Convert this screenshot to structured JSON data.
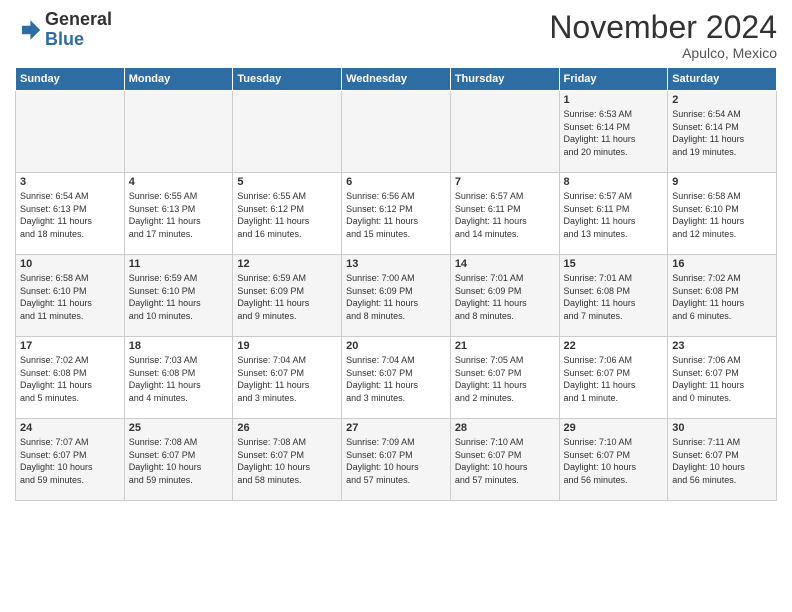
{
  "header": {
    "logo_line1": "General",
    "logo_line2": "Blue",
    "month": "November 2024",
    "location": "Apulco, Mexico"
  },
  "weekdays": [
    "Sunday",
    "Monday",
    "Tuesday",
    "Wednesday",
    "Thursday",
    "Friday",
    "Saturday"
  ],
  "weeks": [
    [
      {
        "day": "",
        "info": ""
      },
      {
        "day": "",
        "info": ""
      },
      {
        "day": "",
        "info": ""
      },
      {
        "day": "",
        "info": ""
      },
      {
        "day": "",
        "info": ""
      },
      {
        "day": "1",
        "info": "Sunrise: 6:53 AM\nSunset: 6:14 PM\nDaylight: 11 hours\nand 20 minutes."
      },
      {
        "day": "2",
        "info": "Sunrise: 6:54 AM\nSunset: 6:14 PM\nDaylight: 11 hours\nand 19 minutes."
      }
    ],
    [
      {
        "day": "3",
        "info": "Sunrise: 6:54 AM\nSunset: 6:13 PM\nDaylight: 11 hours\nand 18 minutes."
      },
      {
        "day": "4",
        "info": "Sunrise: 6:55 AM\nSunset: 6:13 PM\nDaylight: 11 hours\nand 17 minutes."
      },
      {
        "day": "5",
        "info": "Sunrise: 6:55 AM\nSunset: 6:12 PM\nDaylight: 11 hours\nand 16 minutes."
      },
      {
        "day": "6",
        "info": "Sunrise: 6:56 AM\nSunset: 6:12 PM\nDaylight: 11 hours\nand 15 minutes."
      },
      {
        "day": "7",
        "info": "Sunrise: 6:57 AM\nSunset: 6:11 PM\nDaylight: 11 hours\nand 14 minutes."
      },
      {
        "day": "8",
        "info": "Sunrise: 6:57 AM\nSunset: 6:11 PM\nDaylight: 11 hours\nand 13 minutes."
      },
      {
        "day": "9",
        "info": "Sunrise: 6:58 AM\nSunset: 6:10 PM\nDaylight: 11 hours\nand 12 minutes."
      }
    ],
    [
      {
        "day": "10",
        "info": "Sunrise: 6:58 AM\nSunset: 6:10 PM\nDaylight: 11 hours\nand 11 minutes."
      },
      {
        "day": "11",
        "info": "Sunrise: 6:59 AM\nSunset: 6:10 PM\nDaylight: 11 hours\nand 10 minutes."
      },
      {
        "day": "12",
        "info": "Sunrise: 6:59 AM\nSunset: 6:09 PM\nDaylight: 11 hours\nand 9 minutes."
      },
      {
        "day": "13",
        "info": "Sunrise: 7:00 AM\nSunset: 6:09 PM\nDaylight: 11 hours\nand 8 minutes."
      },
      {
        "day": "14",
        "info": "Sunrise: 7:01 AM\nSunset: 6:09 PM\nDaylight: 11 hours\nand 8 minutes."
      },
      {
        "day": "15",
        "info": "Sunrise: 7:01 AM\nSunset: 6:08 PM\nDaylight: 11 hours\nand 7 minutes."
      },
      {
        "day": "16",
        "info": "Sunrise: 7:02 AM\nSunset: 6:08 PM\nDaylight: 11 hours\nand 6 minutes."
      }
    ],
    [
      {
        "day": "17",
        "info": "Sunrise: 7:02 AM\nSunset: 6:08 PM\nDaylight: 11 hours\nand 5 minutes."
      },
      {
        "day": "18",
        "info": "Sunrise: 7:03 AM\nSunset: 6:08 PM\nDaylight: 11 hours\nand 4 minutes."
      },
      {
        "day": "19",
        "info": "Sunrise: 7:04 AM\nSunset: 6:07 PM\nDaylight: 11 hours\nand 3 minutes."
      },
      {
        "day": "20",
        "info": "Sunrise: 7:04 AM\nSunset: 6:07 PM\nDaylight: 11 hours\nand 3 minutes."
      },
      {
        "day": "21",
        "info": "Sunrise: 7:05 AM\nSunset: 6:07 PM\nDaylight: 11 hours\nand 2 minutes."
      },
      {
        "day": "22",
        "info": "Sunrise: 7:06 AM\nSunset: 6:07 PM\nDaylight: 11 hours\nand 1 minute."
      },
      {
        "day": "23",
        "info": "Sunrise: 7:06 AM\nSunset: 6:07 PM\nDaylight: 11 hours\nand 0 minutes."
      }
    ],
    [
      {
        "day": "24",
        "info": "Sunrise: 7:07 AM\nSunset: 6:07 PM\nDaylight: 10 hours\nand 59 minutes."
      },
      {
        "day": "25",
        "info": "Sunrise: 7:08 AM\nSunset: 6:07 PM\nDaylight: 10 hours\nand 59 minutes."
      },
      {
        "day": "26",
        "info": "Sunrise: 7:08 AM\nSunset: 6:07 PM\nDaylight: 10 hours\nand 58 minutes."
      },
      {
        "day": "27",
        "info": "Sunrise: 7:09 AM\nSunset: 6:07 PM\nDaylight: 10 hours\nand 57 minutes."
      },
      {
        "day": "28",
        "info": "Sunrise: 7:10 AM\nSunset: 6:07 PM\nDaylight: 10 hours\nand 57 minutes."
      },
      {
        "day": "29",
        "info": "Sunrise: 7:10 AM\nSunset: 6:07 PM\nDaylight: 10 hours\nand 56 minutes."
      },
      {
        "day": "30",
        "info": "Sunrise: 7:11 AM\nSunset: 6:07 PM\nDaylight: 10 hours\nand 56 minutes."
      }
    ]
  ]
}
